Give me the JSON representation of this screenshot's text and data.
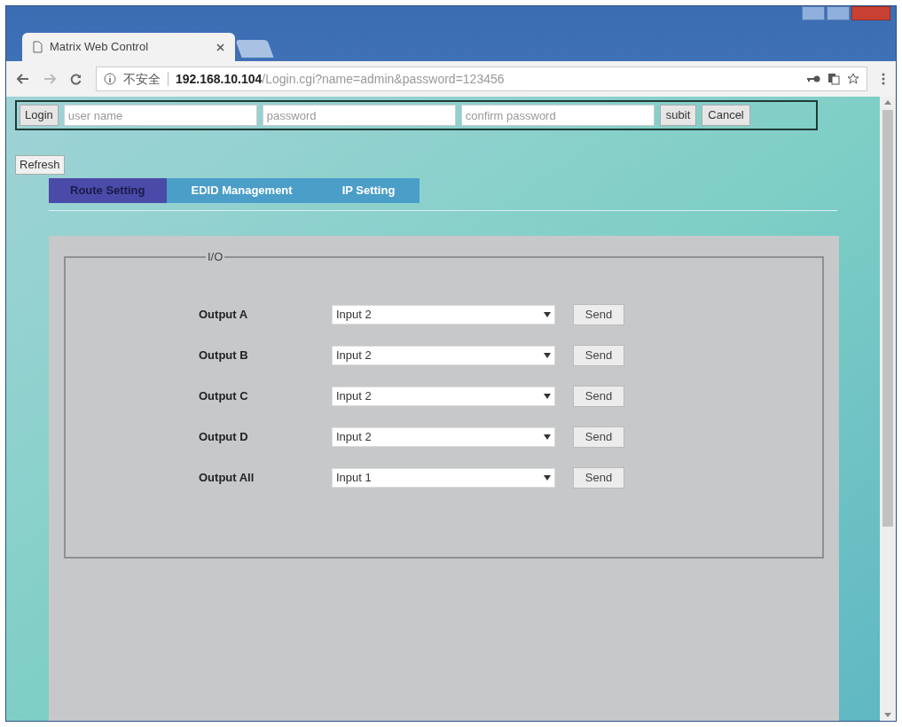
{
  "browser": {
    "tab_title": "Matrix Web Control",
    "security_label": "不安全",
    "url_host": "192.168.10.104",
    "url_path": "/Login.cgi?name=admin&password=123456"
  },
  "login_bar": {
    "login_label": "Login",
    "fields": [
      {
        "placeholder": "user name"
      },
      {
        "placeholder": "password"
      },
      {
        "placeholder": "confirm password"
      }
    ],
    "buttons": [
      "subit",
      "Cancel"
    ]
  },
  "refresh_button": "Refresh",
  "tabs": [
    {
      "label": "Route Setting",
      "selected": true
    },
    {
      "label": "EDID Management",
      "selected": false
    },
    {
      "label": "IP Setting",
      "selected": false
    }
  ],
  "io_panel": {
    "legend": "I/O",
    "rows": [
      {
        "label": "Output A",
        "value": "Input 2",
        "button": "Send"
      },
      {
        "label": "Output B",
        "value": "Input 2",
        "button": "Send"
      },
      {
        "label": "Output C",
        "value": "Input 2",
        "button": "Send"
      },
      {
        "label": "Output D",
        "value": "Input 2",
        "button": "Send"
      },
      {
        "label": "Output All",
        "value": "Input 1",
        "button": "Send"
      }
    ]
  }
}
